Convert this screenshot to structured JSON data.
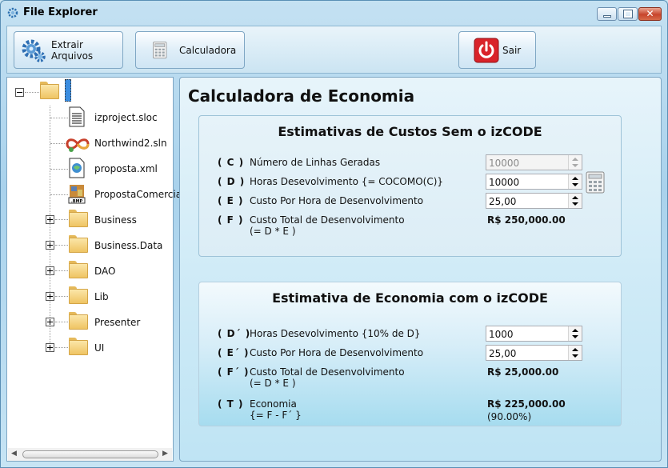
{
  "window": {
    "title": "File Explorer"
  },
  "toolbar": {
    "extrair_label": "Extrair Arquivos",
    "calc_label": "Calculadora",
    "sair_label": "Sair"
  },
  "tree": {
    "root_label": "",
    "files": [
      {
        "label": "izproject.sloc",
        "icon": "document-icon"
      },
      {
        "label": "Northwind2.sln",
        "icon": "visual-studio-icon"
      },
      {
        "label": "proposta.xml",
        "icon": "xml-file-icon"
      },
      {
        "label": "PropostaComercial.p",
        "icon": "bmp-file-icon"
      }
    ],
    "folders": [
      "Business",
      "Business.Data",
      "DAO",
      "Lib",
      "Presenter",
      "UI"
    ]
  },
  "main": {
    "title": "Calculadora de Economia",
    "sem": {
      "title": "Estimativas de Custos Sem o izCODE",
      "rows": [
        {
          "key": "( C )",
          "label": "Número de Linhas Geradas",
          "input": "10000"
        },
        {
          "key": "( D )",
          "label": "Horas Desevolvimento {= COCOMO(C)}",
          "input": "10000"
        },
        {
          "key": "( E )",
          "label": "Custo Por Hora de Desenvolvimento",
          "input": "25,00"
        },
        {
          "key": "( F )",
          "label": "Custo Total de Desenvolvimento",
          "label2": "(= D * E )",
          "value": "R$ 250,000.00"
        }
      ]
    },
    "com": {
      "title": "Estimativa de Economia com o izCODE",
      "rows": [
        {
          "key": "( D´ )",
          "label": "Horas Desevolvimento {10% de D}",
          "input": "1000"
        },
        {
          "key": "( E´ )",
          "label": "Custo Por Hora de Desenvolvimento",
          "input": "25,00"
        },
        {
          "key": "( F´ )",
          "label": "Custo Total de Desenvolvimento",
          "label2": "(= D * E )",
          "value": "R$ 25,000.00"
        },
        {
          "key": "( T )",
          "label": "Economia",
          "label2": "{= F - F´ }",
          "value": "R$ 225,000.00",
          "value2": "(90.00%)"
        }
      ]
    }
  }
}
